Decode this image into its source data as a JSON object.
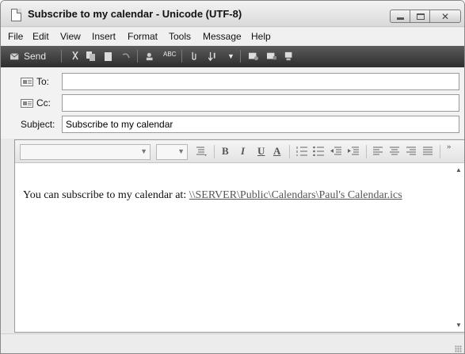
{
  "window": {
    "title": "Subscribe to my calendar - Unicode (UTF-8)"
  },
  "menu": [
    "File",
    "Edit",
    "View",
    "Insert",
    "Format",
    "Tools",
    "Message",
    "Help"
  ],
  "toolbar": {
    "send_label": "Send",
    "spell_label": "ABC"
  },
  "fields": {
    "to_label": "To:",
    "to_value": "",
    "cc_label": "Cc:",
    "cc_value": "",
    "subject_label": "Subject:",
    "subject_value": "Subscribe to my calendar"
  },
  "format": {
    "bold": "B",
    "italic": "I",
    "underline": "U",
    "color": "A",
    "more": "»"
  },
  "body": {
    "text": "You can subscribe to my calendar at:",
    "link": "\\\\SERVER\\Public\\Calendars\\Paul's  Calendar.ics"
  },
  "icons": [
    "document-icon",
    "minimize-icon",
    "maximize-icon",
    "close-icon",
    "send-icon",
    "cut-icon",
    "copy-icon",
    "paste-icon",
    "undo-icon",
    "check-names-icon",
    "spelling-icon",
    "attach-icon",
    "priority-icon",
    "sign-icon",
    "encrypt-icon",
    "offline-icon",
    "address-card-icon",
    "paragraph-style-icon",
    "numbered-list-icon",
    "bulleted-list-icon",
    "decrease-indent-icon",
    "increase-indent-icon",
    "align-left-icon",
    "align-center-icon",
    "align-right-icon",
    "justify-icon"
  ]
}
